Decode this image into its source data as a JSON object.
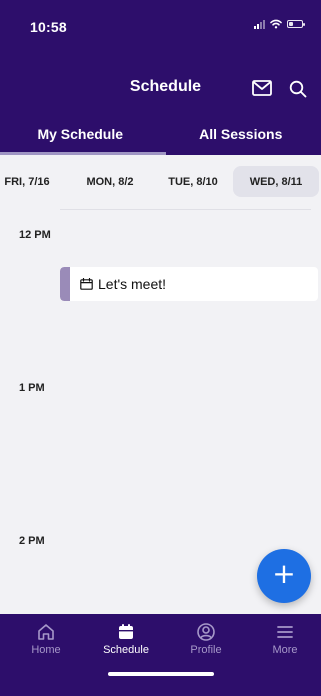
{
  "status_bar": {
    "time": "10:58"
  },
  "header": {
    "title": "Schedule",
    "mail_icon": "mail-icon",
    "search_icon": "search-icon"
  },
  "tabs": [
    {
      "label": "My Schedule",
      "selected": true
    },
    {
      "label": "All Sessions",
      "selected": false
    }
  ],
  "day_strip": [
    {
      "label": "FRI, 7/16",
      "selected": false
    },
    {
      "label": "MON, 8/2",
      "selected": false
    },
    {
      "label": "TUE, 8/10",
      "selected": false
    },
    {
      "label": "WED, 8/11",
      "selected": true
    }
  ],
  "timeline": {
    "hours": [
      "12 PM",
      "1 PM",
      "2 PM"
    ],
    "event": {
      "title": "Let's meet!",
      "icon": "calendar-icon"
    }
  },
  "fab": {
    "label": "+"
  },
  "bottom_nav": [
    {
      "label": "Home",
      "icon": "home-icon",
      "active": false
    },
    {
      "label": "Schedule",
      "icon": "calendar-icon",
      "active": true
    },
    {
      "label": "Profile",
      "icon": "profile-icon",
      "active": false
    },
    {
      "label": "More",
      "icon": "menu-icon",
      "active": false
    }
  ],
  "colors": {
    "header_bg": "#2d0e6b",
    "tab_indicator": "#9f95c3",
    "event_accent": "#9a8bb8",
    "fab": "#1e6fe3",
    "nav_inactive": "#a698c9"
  }
}
